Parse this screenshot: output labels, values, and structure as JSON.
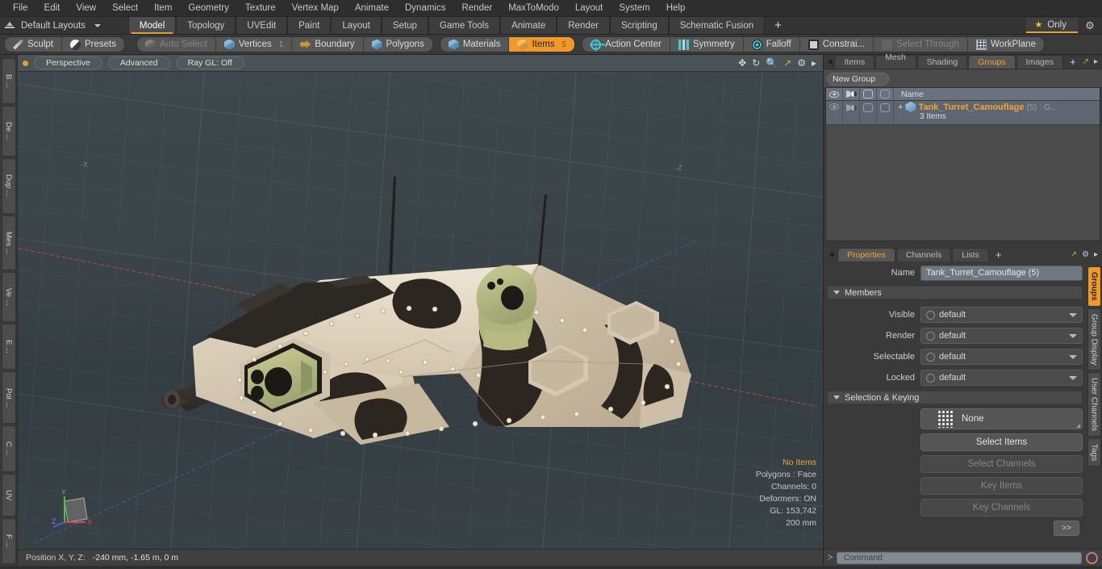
{
  "menu": {
    "items": [
      "File",
      "Edit",
      "View",
      "Select",
      "Item",
      "Geometry",
      "Texture",
      "Vertex Map",
      "Animate",
      "Dynamics",
      "Render",
      "MaxToModo",
      "Layout",
      "System",
      "Help"
    ]
  },
  "layoutbar": {
    "layout_label": "Default Layouts",
    "tabs": [
      "Model",
      "Topology",
      "UVEdit",
      "Paint",
      "Layout",
      "Setup",
      "Game Tools",
      "Animate",
      "Render",
      "Scripting",
      "Schematic Fusion"
    ],
    "active_tab": "Model",
    "add_tab": "+",
    "only_label": "Only",
    "star_glyph": "★",
    "gear_glyph": "⚙"
  },
  "modebar": {
    "group1": [
      {
        "label": "Sculpt",
        "icon": "pencil-icon",
        "state": "normal"
      },
      {
        "label": "Presets",
        "icon": "sphere-icon",
        "state": "normal"
      }
    ],
    "group2": [
      {
        "label": "Auto Select",
        "icon": "cube-grey-icon",
        "state": "dim",
        "count": ""
      },
      {
        "label": "Vertices",
        "icon": "cube-blue-icon",
        "state": "normal",
        "count": "1"
      },
      {
        "label": "Boundary",
        "icon": "boundary-icon",
        "state": "normal",
        "count": ""
      },
      {
        "label": "Polygons",
        "icon": "cube-blue-icon",
        "state": "normal",
        "count": ""
      }
    ],
    "group3": [
      {
        "label": "Materials",
        "icon": "cube-blue-icon",
        "state": "normal",
        "count": ""
      },
      {
        "label": "Items",
        "icon": "cube-orange-icon",
        "state": "active",
        "count": "5"
      }
    ],
    "group4": [
      {
        "label": "Action Center",
        "icon": "target-icon",
        "state": "normal"
      },
      {
        "label": "Symmetry",
        "icon": "symmetry-icon",
        "state": "normal"
      },
      {
        "label": "Falloff",
        "icon": "falloff-icon",
        "state": "normal"
      },
      {
        "label": "Constrai...",
        "icon": "constrain-icon",
        "state": "normal"
      },
      {
        "label": "Select Through",
        "icon": "select-through-icon",
        "state": "dim"
      },
      {
        "label": "WorkPlane",
        "icon": "workplane-icon",
        "state": "normal"
      }
    ]
  },
  "left_strip": {
    "tabs": [
      "B ...",
      "De ...",
      "Dup ...",
      "Mes ...",
      "Ve ...",
      "E ...",
      "Pol ...",
      "C ...",
      "UV",
      "F ..."
    ]
  },
  "viewport": {
    "pills": [
      "Perspective",
      "Advanced",
      "Ray GL: Off"
    ],
    "nav_icons": [
      "move-icon",
      "rotate-icon",
      "zoom-icon",
      "maximize-icon",
      "gear-icon",
      "chevron-right-icon"
    ],
    "axis_labels": {
      "x": "-X",
      "z": "-Z"
    },
    "gizmo_axes": {
      "x": "X",
      "y": "Y",
      "z": "Z"
    },
    "stats": [
      {
        "text": "No Items",
        "highlight": true
      },
      {
        "text": "Polygons : Face",
        "highlight": false
      },
      {
        "text": "Channels: 0",
        "highlight": false
      },
      {
        "text": "Deformers: ON",
        "highlight": false
      },
      {
        "text": "GL: 153,742",
        "highlight": false
      },
      {
        "text": "200 mm",
        "highlight": false
      }
    ]
  },
  "statusbar": {
    "position_label": "Position X, Y, Z:",
    "position_value": "-240 mm, -1.65 m, 0 m"
  },
  "right_panel": {
    "top_tabs": [
      "Items",
      "Mesh ...",
      "Shading",
      "Groups",
      "Images"
    ],
    "top_tabs_active": "Groups",
    "top_tabs_plus": "+",
    "new_group_button": "New Group",
    "list_header": {
      "name": "Name"
    },
    "list_rows": [
      {
        "expander": "+",
        "title": "Tank_Turret_Camouflage",
        "suffix": "(5) : G...",
        "subtitle": "3 Items"
      }
    ],
    "prop_tabs": [
      "Properties",
      "Channels",
      "Lists"
    ],
    "prop_tabs_active": "Properties",
    "prop_tabs_plus": "+",
    "name_label": "Name",
    "name_value": "Tank_Turret_Camouflage (5)",
    "members_section": "Members",
    "members": [
      {
        "label": "Visible",
        "value": "default"
      },
      {
        "label": "Render",
        "value": "default"
      },
      {
        "label": "Selectable",
        "value": "default"
      },
      {
        "label": "Locked",
        "value": "default"
      }
    ],
    "selection_section": "Selection & Keying",
    "selection_dropdown": "None",
    "selection_buttons": [
      {
        "label": "Select Items",
        "enabled": true
      },
      {
        "label": "Select Channels",
        "enabled": false
      },
      {
        "label": "Key Items",
        "enabled": false
      },
      {
        "label": "Key Channels",
        "enabled": false
      }
    ],
    "forward_button": ">>",
    "side_tabs": [
      "Groups",
      "Group Display",
      "User Channels",
      "Tags"
    ],
    "side_tabs_active": "Groups"
  },
  "command_bar": {
    "prompt": ">",
    "placeholder": "Command",
    "record_icon": "record-icon"
  },
  "colors": {
    "accent": "#f0992b",
    "accent_text": "#f0a533",
    "tab_underline": "#e5a030",
    "panel_bg": "#3a3a3a",
    "viewport_bg": "#3a4347",
    "axis_x": "#c1504a",
    "axis_z": "#3f5fb8",
    "tank_tan": "#ddd0bc",
    "tank_dark": "#2b2620",
    "tank_olive": "#b9bd84"
  }
}
